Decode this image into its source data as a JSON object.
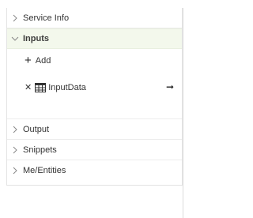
{
  "sections": {
    "service_info": {
      "label": "Service Info",
      "icon": "chevron-right-icon"
    },
    "inputs": {
      "label": "Inputs",
      "icon": "chevron-down-icon",
      "add_label": "Add",
      "items": [
        {
          "name": "InputData",
          "icon": "table-icon"
        }
      ]
    },
    "output": {
      "label": "Output",
      "icon": "chevron-right-icon"
    },
    "snippets": {
      "label": "Snippets",
      "icon": "chevron-right-icon"
    },
    "me_entities": {
      "label": "Me/Entities",
      "icon": "chevron-right-icon"
    }
  },
  "colors": {
    "open_section_bg": "#f3f8ec",
    "border": "#e3e3e3"
  }
}
